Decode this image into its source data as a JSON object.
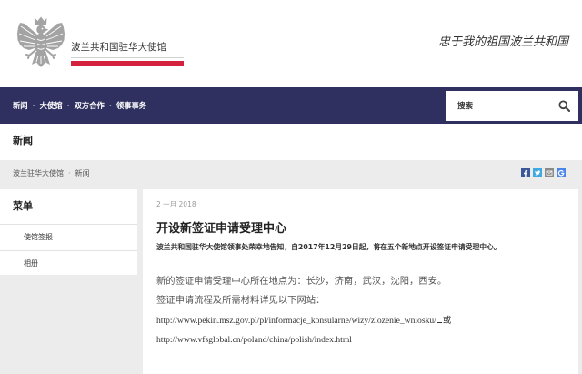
{
  "colors": {
    "nav_bg": "#2f305f",
    "accent_red": "#d4213d",
    "page_bg": "#ececec",
    "facebook": "#3b5998",
    "twitter": "#3fa9e0",
    "email": "#8a8a8a",
    "google_plus": "#4a86e8"
  },
  "header": {
    "emblem_icon": "polish-eagle-emblem-icon",
    "site_name": "波兰共和国驻华大使馆",
    "motto": "忠于我的祖国波兰共和国"
  },
  "nav": {
    "separator": "·",
    "items": [
      {
        "label": "新闻"
      },
      {
        "label": "大使馆"
      },
      {
        "label": "双方合作"
      },
      {
        "label": "领事事务"
      }
    ],
    "search": {
      "placeholder": "搜索",
      "icon": "search-icon"
    }
  },
  "page": {
    "title": "新闻"
  },
  "breadcrumb": {
    "separator": "·",
    "items": [
      "波兰驻华大使馆",
      "新闻"
    ]
  },
  "share": {
    "icons": [
      "facebook-icon",
      "twitter-icon",
      "email-icon",
      "google-plus-icon"
    ]
  },
  "sidebar": {
    "title": "菜单",
    "items": [
      {
        "label": "使馆签报"
      },
      {
        "label": "相册"
      }
    ]
  },
  "article": {
    "date": "2 一月 2018",
    "title": "开设新签证申请受理中心",
    "lead": "波兰共和国驻华大使馆领事处荣幸地告知，自2017年12月29日起，将在五个新地点开设签证申请受理中心。",
    "paragraphs": [
      "新的签证申请受理中心所在地点为：长沙，济南，武汉，沈阳，西安。",
      "签证申请流程及所需材料详见以下网站："
    ],
    "links": [
      {
        "url": "http://www.pekin.msz.gov.pl/pl/informacje_konsularne/wizy/zlozenie_wniosku/",
        "suffix": "或"
      },
      {
        "url": "http://www.vfsglobal.cn/poland/china/polish/index.html"
      }
    ]
  }
}
